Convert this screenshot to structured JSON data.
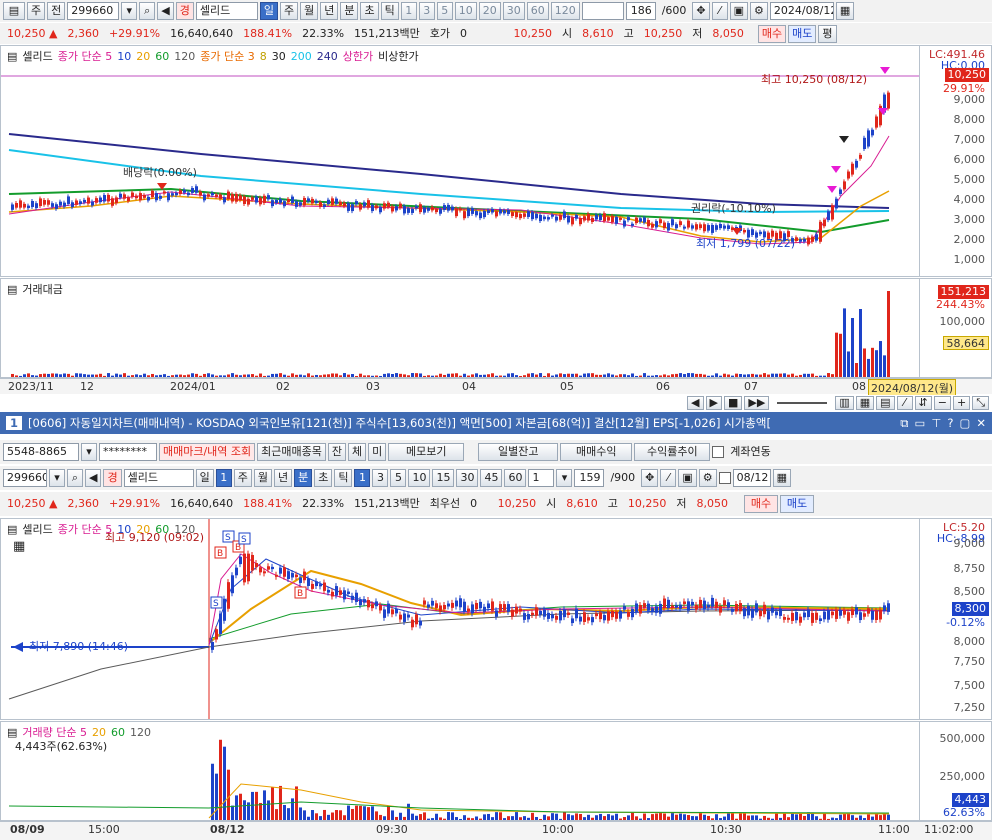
{
  "top": {
    "toolbar": {
      "mode1": "주",
      "mode2": "전",
      "code": "299660",
      "name_badge": "경",
      "name": "셀리드",
      "periods": [
        "일",
        "주",
        "월",
        "년",
        "분",
        "초",
        "틱"
      ],
      "intervals": [
        "1",
        "3",
        "5",
        "10",
        "20",
        "30",
        "60",
        "120"
      ],
      "count": "186",
      "count_total": "/600",
      "date": "2024/08/12"
    },
    "quote": {
      "price": "10,250",
      "change": "2,360",
      "rate": "+29.91%",
      "volume": "16,640,640",
      "vol_ratio": "188.41%",
      "turnover": "22.33%",
      "amount": "151,213백만",
      "hoga_label": "호가",
      "hoga": "0",
      "cur": "10,250",
      "open_label": "시",
      "open": "8,610",
      "high_label": "고",
      "high": "10,250",
      "low_label": "저",
      "low": "8,050",
      "buy": "매수",
      "sell": "매도",
      "flat": "평"
    },
    "legend": {
      "name": "셀리드",
      "ma1_label": "종가 단순 5",
      "ma1_periods": [
        "10",
        "20",
        "60",
        "120"
      ],
      "ma2_label": "종가 단순 3",
      "ma2_periods": [
        "8",
        "30",
        "200",
        "240"
      ],
      "limit_up": "상한가",
      "limit_down": "비상한가"
    },
    "annotations": {
      "high": "최고 10,250 (08/12)",
      "low": "최저 1,799 (07/22)",
      "dividend": "배당락(0.00%)",
      "rights": "권리락(-10.10%)"
    },
    "price_axis": [
      "LC:491.46",
      "HC:0.00",
      "10,250",
      "29.91%",
      "9,000",
      "8,000",
      "7,000",
      "6,000",
      "5,000",
      "4,000",
      "3,000",
      "2,000",
      "1,000"
    ],
    "vol_title": "거래대금",
    "vol_axis": [
      "151,213",
      "244.43%",
      "100,000",
      "58,664"
    ],
    "x_labels": [
      "2023/11",
      "12",
      "2024/01",
      "02",
      "03",
      "04",
      "05",
      "06",
      "07",
      "08",
      "2024/08/12(월)"
    ]
  },
  "window": {
    "title": "[0606] 자동일지차트(매매내역) - KOSDAQ 외국인보유[121(천)] 주식수[13,603(천)] 액면[500] 자본금[68(억)] 결산[12월] EPS[-1,026] 시가총액[",
    "num": "1",
    "account": "5548-8865",
    "password": "********",
    "buttons": [
      "매매마크/내역 조회",
      "최근매매종목",
      "잔",
      "체",
      "미",
      "메모보기",
      "일별잔고",
      "매매수익",
      "수익률추이"
    ],
    "account_check": "계좌연동",
    "toolbar": {
      "code": "299660",
      "name_badge": "경",
      "name": "셀리드",
      "periods": [
        "일",
        "주",
        "월",
        "년",
        "분",
        "초",
        "틱"
      ],
      "intervals": [
        "1",
        "3",
        "5",
        "10",
        "15",
        "30",
        "45",
        "60"
      ],
      "unit": "1",
      "count": "159",
      "count_total": "/900",
      "date": "08/12"
    },
    "quote": {
      "price": "10,250",
      "change": "2,360",
      "rate": "+29.91%",
      "volume": "16,640,640",
      "vol_ratio": "188.41%",
      "turnover": "22.33%",
      "amount": "151,213백만",
      "hoga_label": "최우선",
      "hoga": "0",
      "cur": "10,250",
      "open_label": "시",
      "open": "8,610",
      "high_label": "고",
      "high": "10,250",
      "low_label": "저",
      "low": "8,050",
      "buy": "매수",
      "sell": "매도"
    },
    "legend": {
      "name": "셀리드",
      "ma_label": "종가 단순 5",
      "ma_periods": [
        "10",
        "20",
        "60",
        "120"
      ]
    },
    "annotations": {
      "high": "최고 9,120 (09:02)",
      "low": "최저 7,890 (14:46)"
    },
    "price_axis": [
      "LC:5.20",
      "HC:-8.99",
      "9,000",
      "8,750",
      "8,500",
      "8,300",
      "-0.12%",
      "8,000",
      "7,750",
      "7,500",
      "7,250"
    ],
    "vol_legend": {
      "label": "거래량 단순 5",
      "periods": [
        "20",
        "60",
        "120"
      ],
      "value": "4,443주(62.63%)"
    },
    "vol_axis": [
      "500,000",
      "250,000",
      "4,443",
      "62.63%"
    ],
    "x_labels": [
      "08/09",
      "15:00",
      "08/12",
      "09:30",
      "10:00",
      "10:30",
      "11:00",
      "11:02:00"
    ]
  },
  "colors": {
    "up": "#e0261b",
    "down": "#1d43c9",
    "ma5": "#d81b91",
    "ma10": "#1d43c9",
    "ma20": "#e8a000",
    "ma60": "#139c2c",
    "ma120": "#5a5a5a",
    "title_bar": "#3f6bb3"
  }
}
